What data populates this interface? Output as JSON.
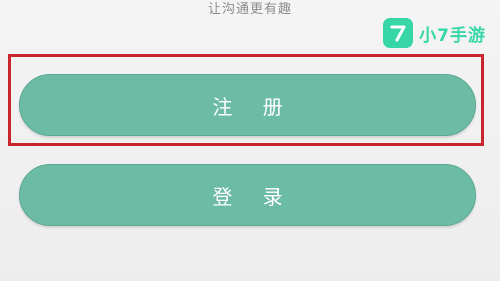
{
  "header": {
    "tagline": "让沟通更有趣"
  },
  "watermark": {
    "logo_glyph": "7",
    "text": "小7手游",
    "color": "#36d6a6"
  },
  "buttons": {
    "register_label": "注 册",
    "login_label": "登 录",
    "color": "#6cbba5"
  },
  "highlight": {
    "color": "#c8262c"
  }
}
